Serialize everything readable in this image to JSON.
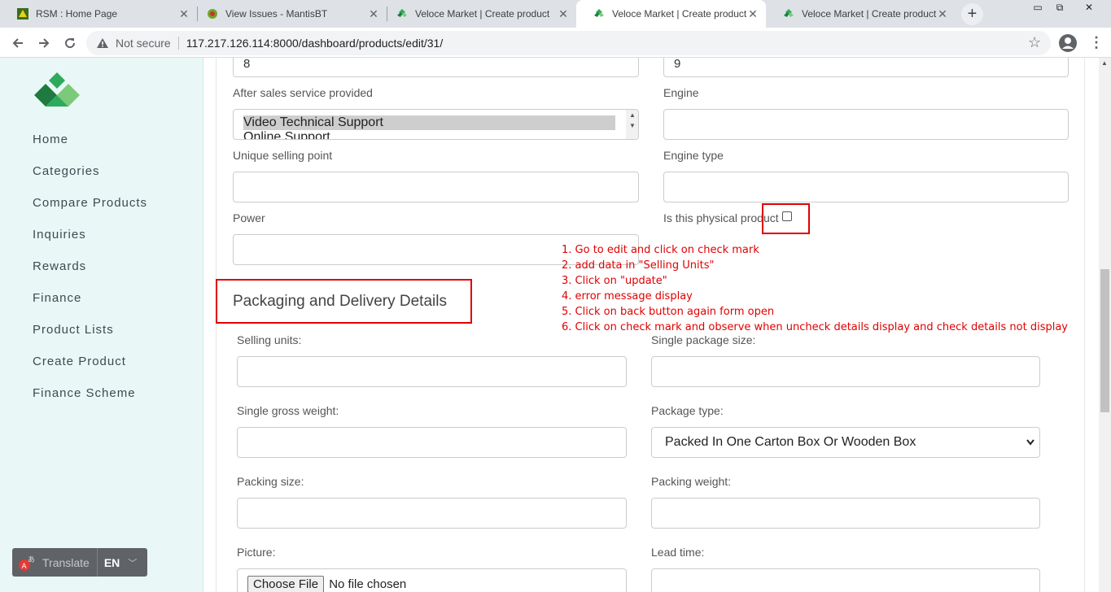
{
  "tabs": [
    {
      "title": "RSM : Home Page",
      "icon": "rsm-favicon"
    },
    {
      "title": "View Issues - MantisBT",
      "icon": "mantis-favicon"
    },
    {
      "title": "Veloce Market | Create product",
      "icon": "veloce-favicon"
    },
    {
      "title": "Veloce Market | Create product",
      "icon": "veloce-favicon",
      "active": true
    },
    {
      "title": "Veloce Market | Create product",
      "icon": "veloce-favicon"
    }
  ],
  "toolbar": {
    "security": "Not secure",
    "url": "117.217.126.114:8000/dashboard/products/edit/31/"
  },
  "sidebar": {
    "items": [
      "Home",
      "Categories",
      "Compare Products",
      "Inquiries",
      "Rewards",
      "Finance",
      "Product Lists",
      "Create Product",
      "Finance Scheme"
    ],
    "translate_label": "Translate",
    "language": "EN"
  },
  "form": {
    "top_left_value": "8",
    "top_right_value": "9",
    "after_sales_label": "After sales service provided",
    "after_sales_options": [
      "Video Technical Support",
      "Online Support"
    ],
    "engine_label": "Engine",
    "usp_label": "Unique selling point",
    "engine_type_label": "Engine type",
    "power_label": "Power",
    "physical_label": "Is this physical product",
    "section_title": "Packaging and Delivery Details",
    "selling_units_label": "Selling units:",
    "single_package_label": "Single package size:",
    "gross_weight_label": "Single gross weight:",
    "package_type_label": "Package type:",
    "package_type_value": "Packed In One Carton Box Or Wooden Box",
    "packing_size_label": "Packing size:",
    "packing_weight_label": "Packing weight:",
    "picture_label": "Picture:",
    "lead_time_label": "Lead time:",
    "choose_file": "Choose File",
    "no_file": "No file chosen"
  },
  "annotation": [
    "1. Go to edit and click on check mark",
    "2. add data in \"Selling Units\"",
    "3. Click on \"update\"",
    "4. error message display",
    "5. Click on back button again form open",
    "6. Click on check mark and observe when uncheck details display and check details not display"
  ],
  "colors": {
    "accent": "#2eaa5c",
    "annotation": "#e00000",
    "sidebar_bg": "#e9f8f6"
  }
}
